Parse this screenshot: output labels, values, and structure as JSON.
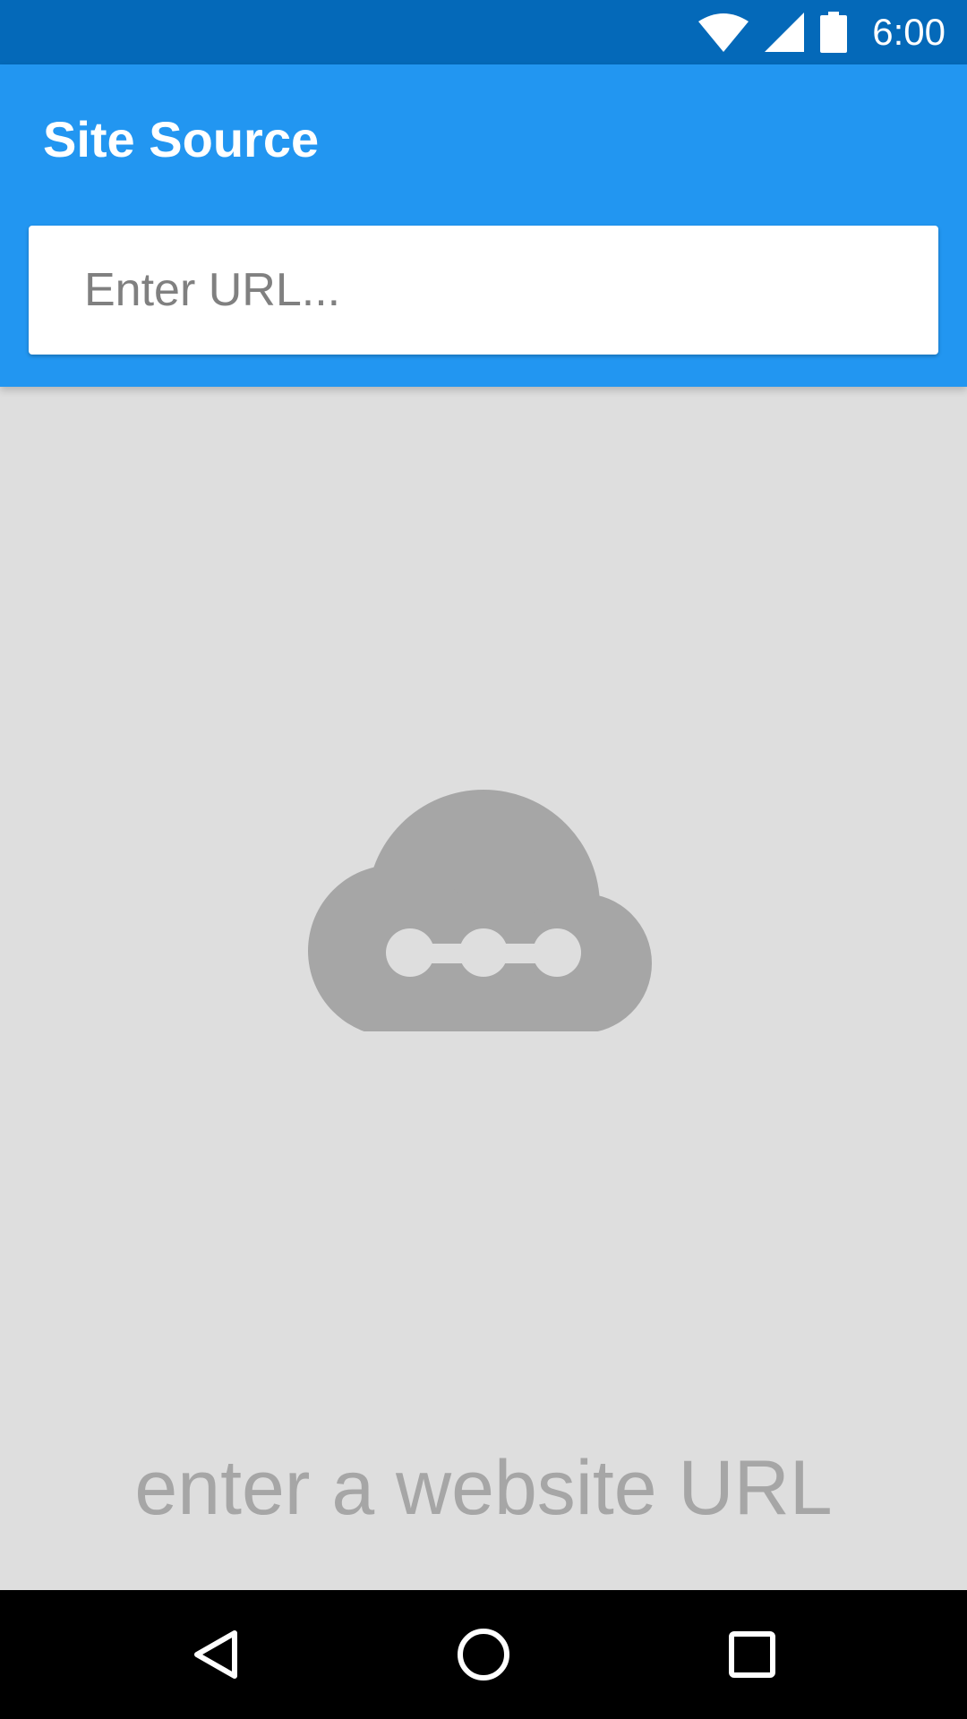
{
  "status_bar": {
    "time": "6:00",
    "icons": [
      "wifi-icon",
      "cell-signal-icon",
      "battery-icon"
    ],
    "color": "#0469b9"
  },
  "app_bar": {
    "title": "Site Source",
    "color": "#2296f1"
  },
  "url_input": {
    "value": "",
    "placeholder": "Enter URL..."
  },
  "empty_state": {
    "icon": "cloud-link-icon",
    "message": "enter a website URL"
  },
  "nav_bar": {
    "buttons": [
      "back-icon",
      "home-icon",
      "recents-icon"
    ]
  }
}
